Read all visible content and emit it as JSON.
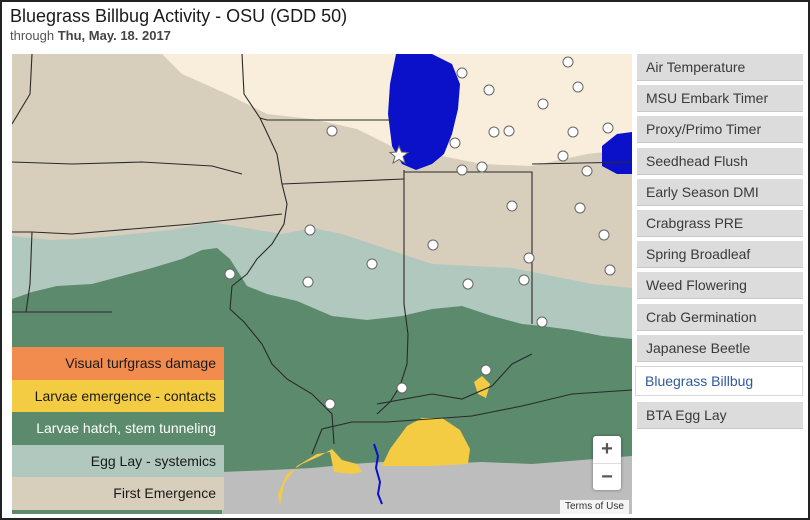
{
  "header": {
    "title": "Bluegrass Billbug Activity - OSU (GDD 50)",
    "subtitle_prefix": "through",
    "subtitle_date": "Thu, May. 18. 2017"
  },
  "legend": {
    "items": [
      {
        "label": "Visual turfgrass damage",
        "color": "#f28b4e"
      },
      {
        "label": "Larvae emergence - contacts",
        "color": "#f4cc43"
      },
      {
        "label": "Larvae hatch, stem tunneling",
        "color": "#5c8a6d"
      },
      {
        "label": "Egg Lay - systemics",
        "color": "#b0c8be"
      },
      {
        "label": "First Emergence",
        "color": "#d8cebc"
      }
    ]
  },
  "map": {
    "zoom_in_label": "+",
    "zoom_out_label": "−",
    "terms_label": "Terms of Use",
    "colors": {
      "water": "#0a11c9",
      "gulf": "#bdbdbd",
      "no_activity": "#f8eedb",
      "first_emergence": "#d8cebc",
      "egg_lay": "#b0c8be",
      "larvae_hatch": "#5c8a6d",
      "larvae_emergence": "#f4cc43"
    }
  },
  "sidebar": {
    "items": [
      {
        "label": "Air Temperature",
        "active": false
      },
      {
        "label": "MSU Embark Timer",
        "active": false
      },
      {
        "label": "Proxy/Primo Timer",
        "active": false
      },
      {
        "label": "Seedhead Flush",
        "active": false
      },
      {
        "label": "Early Season DMI",
        "active": false
      },
      {
        "label": "Crabgrass PRE",
        "active": false
      },
      {
        "label": "Spring Broadleaf",
        "active": false
      },
      {
        "label": "Weed Flowering",
        "active": false
      },
      {
        "label": "Crab Germination",
        "active": false
      },
      {
        "label": "Japanese Beetle",
        "active": false
      },
      {
        "label": "Bluegrass Billbug",
        "active": true
      },
      {
        "label": "BTA Egg Lay",
        "active": false
      }
    ]
  }
}
